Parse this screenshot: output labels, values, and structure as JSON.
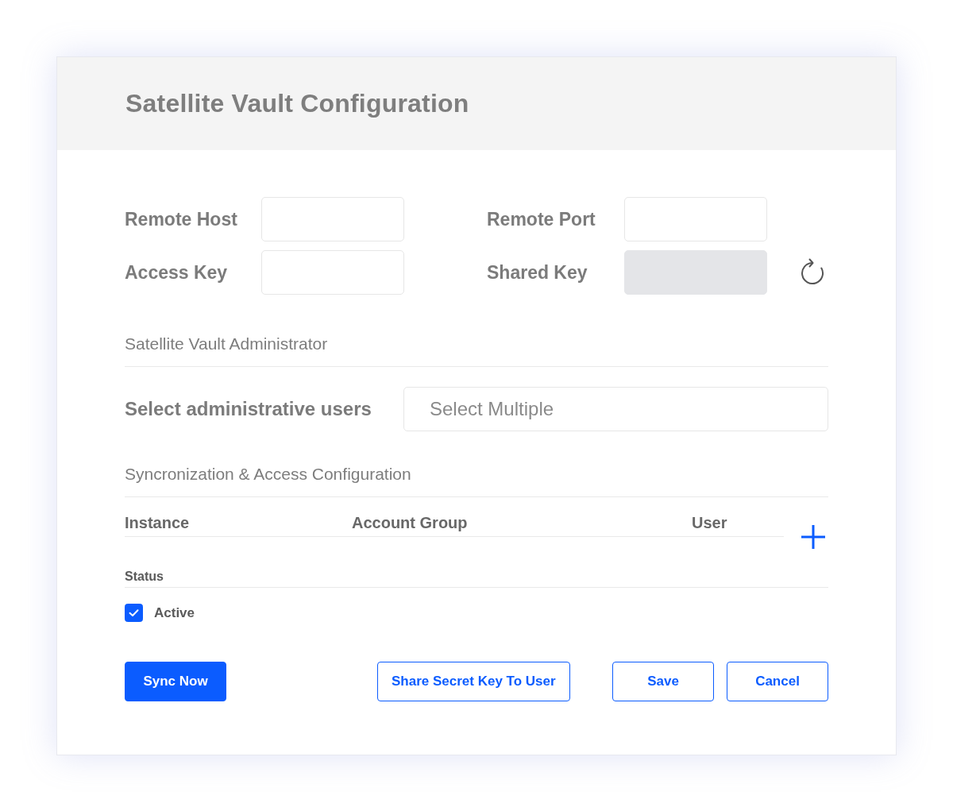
{
  "header": {
    "title": "Satellite Vault Configuration"
  },
  "connection_fields": [
    {
      "label": "Remote Host",
      "kind": "text",
      "disabled": false
    },
    {
      "label": "Remote Port",
      "kind": "text",
      "disabled": false
    },
    {
      "label": "Access Key",
      "kind": "text",
      "disabled": false
    },
    {
      "label": "Shared Key",
      "kind": "generated",
      "disabled": true
    }
  ],
  "administrator_section": {
    "title": "Satellite Vault Administrator",
    "label": "Select administrative users",
    "placeholder": "Select Multiple"
  },
  "sync_section": {
    "title": "Syncronization & Access Configuration",
    "columns": [
      "Instance",
      "Account Group",
      "User"
    ]
  },
  "status": {
    "label": "Status",
    "options": [
      {
        "label": "Active",
        "checked": true
      }
    ]
  },
  "button_groups": [
    [
      {
        "label": "Sync Now",
        "kind": "primary"
      }
    ],
    [
      {
        "label": "Share Secret Key To User",
        "kind": "outline"
      }
    ],
    [
      {
        "label": "Save",
        "kind": "outline"
      },
      {
        "label": "Cancel",
        "kind": "outline"
      }
    ]
  ]
}
